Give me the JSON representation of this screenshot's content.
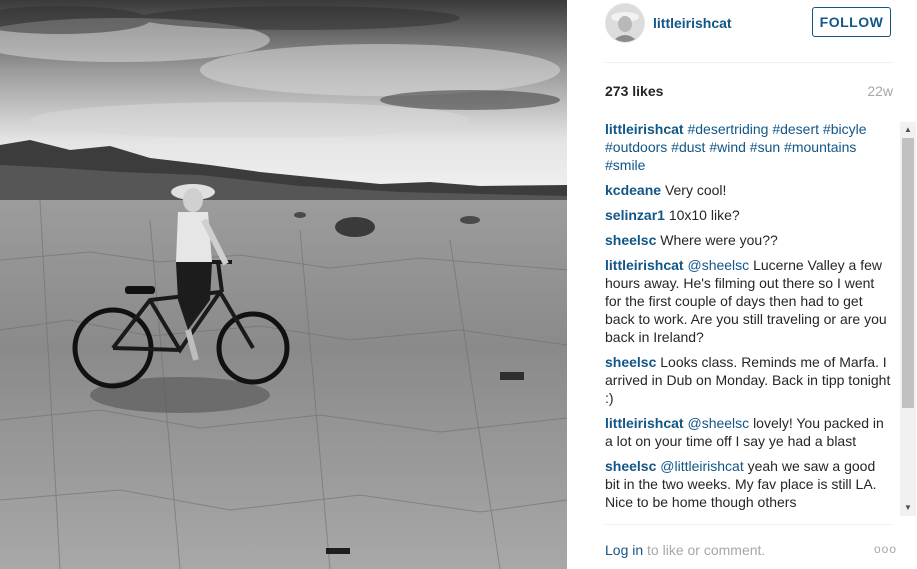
{
  "post": {
    "owner": "littleirishcat",
    "follow_label": "FOLLOW",
    "likes": "273 likes",
    "age": "22w"
  },
  "photo": {
    "icon": "desert-bike-photo"
  },
  "comments": [
    {
      "user": "littleirishcat",
      "tags": [
        "#desertriding",
        "#desert",
        "#bicyle",
        "#outdoors",
        "#dust",
        "#wind",
        "#sun",
        "#mountains",
        "#smile"
      ]
    },
    {
      "user": "kcdeane",
      "text": "Very cool!"
    },
    {
      "user": "selinzar1",
      "text": "10x10 like?"
    },
    {
      "user": "sheelsc",
      "text": "Where were you??"
    },
    {
      "user": "littleirishcat",
      "mention": "@sheelsc",
      "text": "Lucerne Valley a few hours away. He's filming out there so I went for the first couple of days then had to get back to work. Are you still traveling or are you back in Ireland?"
    },
    {
      "user": "sheelsc",
      "text": "Looks class. Reminds me of Marfa. I arrived in Dub on Monday. Back in tipp tonight :)"
    },
    {
      "user": "littleirishcat",
      "mention": "@sheelsc",
      "text": "lovely! You packed in a lot on your time off I say ye had a blast"
    },
    {
      "user": "sheelsc",
      "mention": "@littleirishcat",
      "text": "yeah we saw a good bit in the two weeks. My fav place is still LA. Nice to be home though others"
    }
  ],
  "footer": {
    "login_link": "Log in",
    "login_rest": "to like or comment.",
    "more_label": "ooo"
  },
  "colors": {
    "link": "#125688",
    "text": "#262626",
    "muted": "#a5a7aa",
    "divider": "#efefef"
  }
}
